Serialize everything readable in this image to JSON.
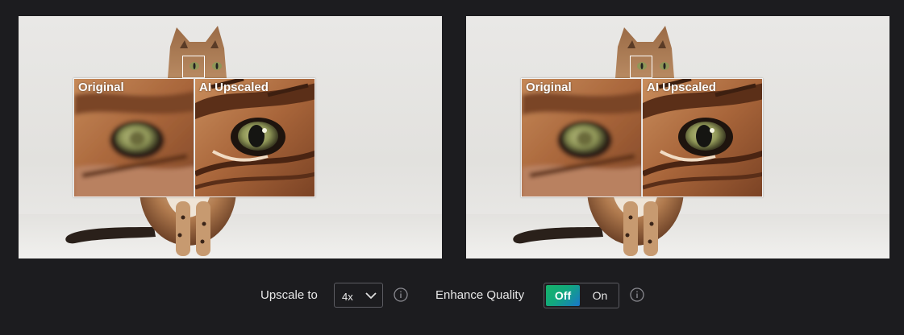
{
  "comparison": {
    "original_label": "Original",
    "upscaled_label": "AI Upscaled"
  },
  "controls": {
    "upscale_label": "Upscale to",
    "upscale_value": "4x",
    "enhance_label": "Enhance Quality",
    "toggle_off_label": "Off",
    "toggle_on_label": "On",
    "toggle_selected": "Off",
    "accent_gradient": [
      "#17b36a",
      "#1976c9"
    ]
  },
  "icons": {
    "dropdown": "chevron-down-icon",
    "info": "info-circle-icon"
  }
}
